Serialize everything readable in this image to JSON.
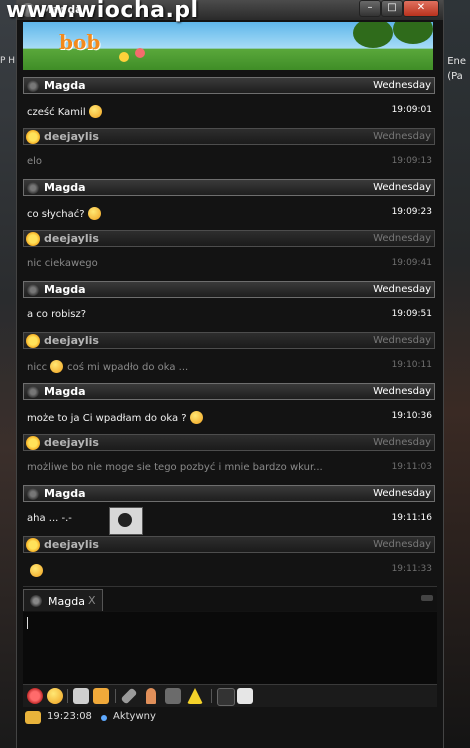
{
  "window": {
    "title": "Magda",
    "watermark": "www.wiocha.pl",
    "banner_logo": "bob"
  },
  "background": {
    "right_text_1": "Ene",
    "right_text_2": "(Pa",
    "left_text": "P H"
  },
  "colors": {
    "accent_status": "#5ea9ff",
    "my_nick": "#b5b5b5",
    "their_nick": "#ffffff"
  },
  "messages": [
    {
      "nick": "Magda",
      "day": "Wednesday",
      "text": "cześć Kamil",
      "time": "19:09:01",
      "me": false,
      "smiley": true
    },
    {
      "nick": "deejaylis",
      "day": "Wednesday",
      "text": "elo",
      "time": "19:09:13",
      "me": true,
      "smiley": false
    },
    {
      "nick": "Magda",
      "day": "Wednesday",
      "text": "co słychać?",
      "time": "19:09:23",
      "me": false,
      "smiley": true
    },
    {
      "nick": "deejaylis",
      "day": "Wednesday",
      "text": "nic ciekawego",
      "time": "19:09:41",
      "me": true,
      "smiley": false
    },
    {
      "nick": "Magda",
      "day": "Wednesday",
      "text": "a co robisz?",
      "time": "19:09:51",
      "me": false,
      "smiley": false
    },
    {
      "nick": "deejaylis",
      "day": "Wednesday",
      "text": "nicc",
      "text2": "coś mi wpadło do oka ...",
      "time": "19:10:11",
      "me": true,
      "smiley": true
    },
    {
      "nick": "Magda",
      "day": "Wednesday",
      "text": "może to ja Ci wpadłam do oka ?",
      "time": "19:10:36",
      "me": false,
      "smiley": true
    },
    {
      "nick": "deejaylis",
      "day": "Wednesday",
      "text": "możliwe bo nie moge sie tego pozbyć i mnie bardzo wkur...",
      "time": "19:11:03",
      "me": true,
      "smiley": false
    },
    {
      "nick": "Magda",
      "day": "Wednesday",
      "text": "aha ... -.-",
      "time": "19:11:16",
      "me": false,
      "smiley": false,
      "image": true
    },
    {
      "nick": "deejaylis",
      "day": "Wednesday",
      "text": "",
      "time": "19:11:33",
      "me": true,
      "smiley": true
    }
  ],
  "tab": {
    "label": "Magda",
    "close": "X"
  },
  "toolbar": {
    "icons": [
      "stop-icon",
      "emoticon-icon",
      "print-icon",
      "send-file-icon",
      "paperclip-icon",
      "person-icon",
      "camera-icon",
      "warning-icon",
      "filter-icon",
      "book-icon"
    ]
  },
  "status": {
    "time": "19:23:08",
    "label": "Aktywny"
  }
}
